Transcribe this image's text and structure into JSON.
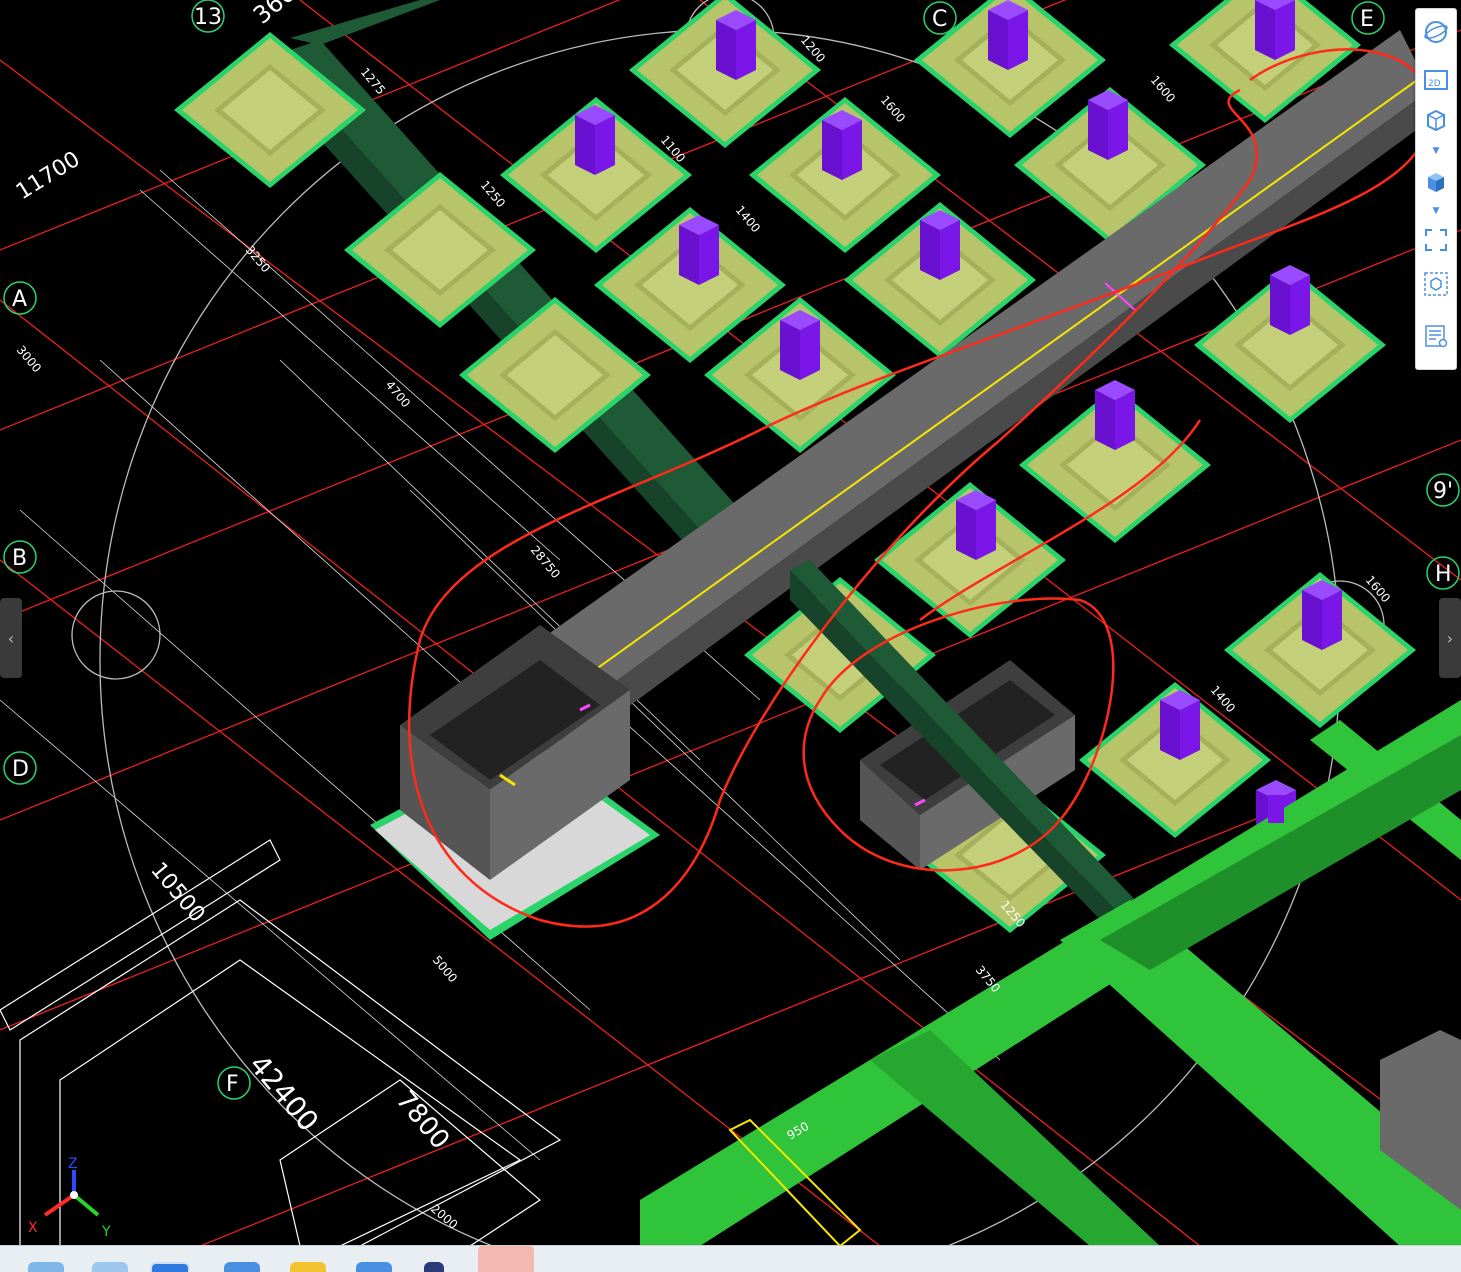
{
  "axes": {
    "bubbles": [
      "A",
      "B",
      "D",
      "F",
      "C",
      "E",
      "H",
      "9'",
      "13"
    ],
    "x_label": "X",
    "y_label": "Y",
    "z_label": "Z"
  },
  "dimensions": {
    "d11700": "11700",
    "d42400": "42400",
    "d7800": "7800",
    "d10500": "10500",
    "d3600": "360",
    "d3000": "3000",
    "d4700": "4700",
    "d3250": "3250",
    "d28750": "28750",
    "d3750": "3750",
    "d5000": "5000",
    "d1600a": "1600",
    "d1600b": "1600",
    "d1600c": "1600",
    "d1400a": "1400",
    "d1400b": "1400",
    "d1250a": "1250",
    "d1250b": "1250",
    "d1100": "1100",
    "d1200": "1200",
    "d1275": "1275",
    "d950": "950",
    "d2000": "2000"
  },
  "toolbar": {
    "tools": [
      {
        "name": "orbit-icon",
        "label": "Orbit"
      },
      {
        "name": "view-2d-icon",
        "label": "2D"
      },
      {
        "name": "view-3d-cube-icon",
        "label": "3D"
      },
      {
        "name": "solid-cube-icon",
        "label": "Solid"
      },
      {
        "name": "fit-view-icon",
        "label": "Fit"
      },
      {
        "name": "section-box-icon",
        "label": "Section"
      },
      {
        "name": "property-list-icon",
        "label": "Properties"
      }
    ]
  },
  "colors": {
    "background": "#000000",
    "footing_top": "#b7c46a",
    "footing_edge": "#2bd46a",
    "column": "#7a16e8",
    "beam": "#5b5b5b",
    "wall": "#1e5a36",
    "ground_beam": "#2fc43a",
    "markup": "#ff2a1a",
    "grid_red": "#ff2020"
  }
}
